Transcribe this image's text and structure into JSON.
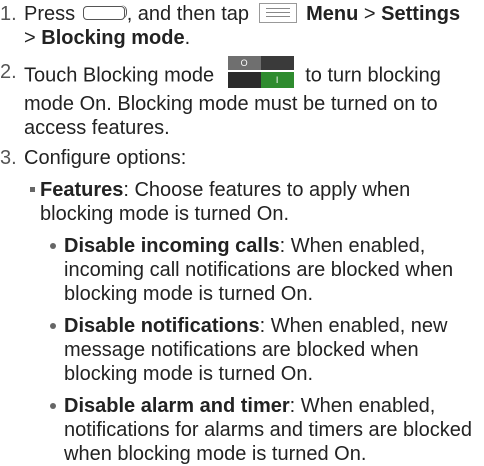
{
  "steps": [
    {
      "num": "1.",
      "a": "Press",
      "b": ", and then tap",
      "menu": "Menu",
      "sep1": ">",
      "settings": "Settings",
      "sep2": ">",
      "blocking": "Blocking mode",
      "end": "."
    },
    {
      "num": "2.",
      "a": "Touch Blocking mode",
      "b": "to turn blocking mode On. Blocking mode must be turned on to access features.",
      "toggle_off": "O",
      "toggle_on": "I"
    },
    {
      "num": "3.",
      "a": "Configure options:"
    }
  ],
  "features": {
    "title": "Features",
    "desc": ": Choose features to apply when blocking mode is turned On."
  },
  "bullets": [
    {
      "title": "Disable incoming calls",
      "desc": ": When enabled, incoming call notifications are blocked when blocking mode is turned On."
    },
    {
      "title": "Disable notifications",
      "desc": ": When enabled, new message notifications are blocked when blocking mode is turned On."
    },
    {
      "title": "Disable alarm and timer",
      "desc": ": When enabled, notifications for alarms and timers are blocked when blocking mode is turned On."
    }
  ],
  "icons": {
    "home_button": "home-button-icon",
    "menu": "menu-icon",
    "toggle": "toggle-switch-icon"
  }
}
